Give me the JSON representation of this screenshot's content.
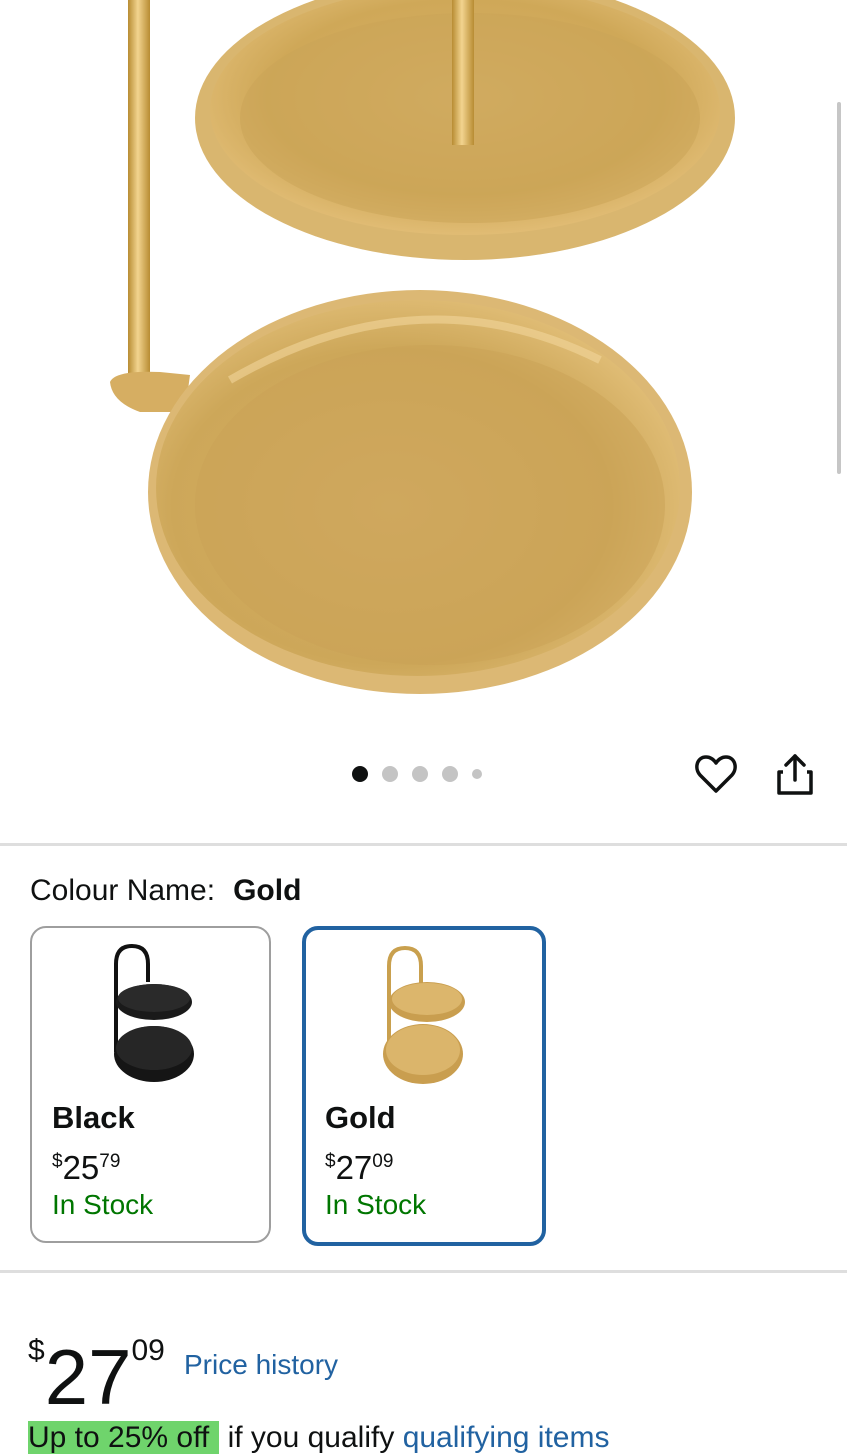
{
  "gallery": {
    "image_alt": "Two-tier gold jewellery tray stand",
    "dot_count": 5,
    "active_dot": 0,
    "wishlist_icon": "heart-outline-icon",
    "share_icon": "share-icon"
  },
  "variation": {
    "label": "Colour Name:",
    "selected": "Gold",
    "options": [
      {
        "name": "Black",
        "currency": "$",
        "whole": "25",
        "fraction": "79",
        "stock": "In Stock"
      },
      {
        "name": "Gold",
        "currency": "$",
        "whole": "27",
        "fraction": "09",
        "stock": "In Stock"
      }
    ]
  },
  "price": {
    "currency": "$",
    "whole": "27",
    "fraction": "09",
    "history_link": "Price history"
  },
  "promo": {
    "badge": "Up to 25% off",
    "text": "if you qualify",
    "link": "qualifying items"
  },
  "colors": {
    "accent": "#2162a1",
    "in_stock": "#007600",
    "promo_badge": "#6fd46c"
  }
}
